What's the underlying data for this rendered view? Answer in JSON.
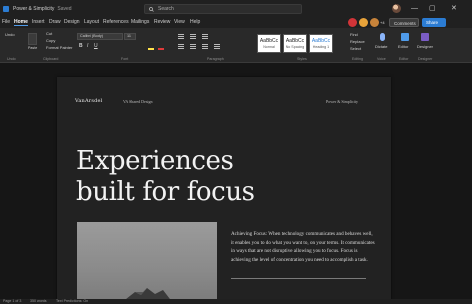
{
  "window": {
    "app_title": "Power & Simplicity",
    "save_state": "Saved",
    "search_placeholder": "Search",
    "minimize": "—",
    "maximize": "▢",
    "close": "✕"
  },
  "menu": {
    "items": [
      "File",
      "Home",
      "Insert",
      "Draw",
      "Design",
      "Layout",
      "References",
      "Mailings",
      "Review",
      "View",
      "Help"
    ],
    "active": "Home"
  },
  "collab": {
    "extra_count": "+4",
    "comments_label": "Comments",
    "share_label": "Share"
  },
  "ribbon": {
    "undo_label": "Undo",
    "paste_label": "Paste",
    "cut_label": "Cut",
    "copy_label": "Copy",
    "format_painter_label": "Format Painter",
    "font_name": "Calibri (Body)",
    "font_size": "11",
    "styles": [
      {
        "sample": "AaBbCc",
        "name": "Normal"
      },
      {
        "sample": "AaBbCc",
        "name": "No Spacing"
      },
      {
        "sample": "AaBbCc",
        "name": "Heading 1"
      }
    ],
    "find_label": "Find",
    "replace_label": "Replace",
    "select_label": "Select",
    "dictate_label": "Dictate",
    "editor_label": "Editor",
    "designer_label": "Designer",
    "groups": [
      "Undo",
      "Clipboard",
      "Font",
      "Paragraph",
      "Styles",
      "Editing",
      "Voice",
      "Editor",
      "Designer"
    ]
  },
  "document": {
    "logo": "VanArsdel",
    "header_center": "VA Shared Design",
    "header_right": "Power & Simplicity",
    "hero_line1": "Experiences",
    "hero_line2": "built for focus",
    "body_text": "Achieving Focus: When technology communicates and behaves well, it enables you to do what you want to, on your terms. It communicates in ways that are not disruptive allowing you to focus. Focus is achieving the level of concentration you need to accomplish a task."
  },
  "statusbar": {
    "page": "Page 1 of 3",
    "words": "350 words",
    "text_predictions": "Text Predictions: On"
  },
  "colors": {
    "accent": "#2b7cd3",
    "page_background": "#222222",
    "share_button": "#2b7cd3"
  }
}
